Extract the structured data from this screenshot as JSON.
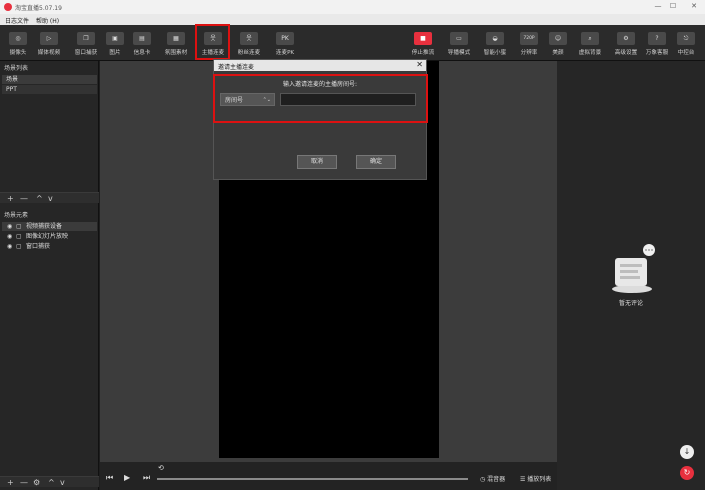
{
  "app": {
    "title": "淘宝直播5.07.19"
  },
  "window_controls": {
    "minimize": "—",
    "maximize": "☐",
    "close": "✕"
  },
  "menu": [
    "日志文件",
    "帮助 (H)"
  ],
  "toolbar": [
    {
      "label": "摄像头",
      "icon": "camera-icon",
      "glyph": "◎"
    },
    {
      "label": "媒体视频",
      "icon": "play-icon",
      "glyph": "▷"
    },
    {
      "label": "窗口捕获",
      "icon": "window-icon",
      "glyph": "❐"
    },
    {
      "label": "图片",
      "icon": "image-icon",
      "glyph": "▣"
    },
    {
      "label": "信息卡",
      "icon": "card-icon",
      "glyph": "▤"
    },
    {
      "label": "氛围素材",
      "icon": "grid-icon",
      "glyph": "▦"
    },
    {
      "label": "主播连麦",
      "icon": "user-link-icon",
      "glyph": "웃"
    },
    {
      "label": "粉丝连麦",
      "icon": "fans-link-icon",
      "glyph": "웃"
    },
    {
      "label": "连麦PK",
      "icon": "pk-icon",
      "glyph": "PK"
    },
    {
      "label": "停止推流",
      "icon": "stop-icon",
      "glyph": "■"
    },
    {
      "label": "导播模式",
      "icon": "director-icon",
      "glyph": "▭"
    },
    {
      "label": "智能小蜜",
      "icon": "assistant-icon",
      "glyph": "◒"
    },
    {
      "label": "分辨率",
      "icon": "resolution-icon",
      "glyph": "720P"
    },
    {
      "label": "美颜",
      "icon": "beauty-icon",
      "glyph": "☺"
    },
    {
      "label": "虚拟背景",
      "icon": "virtual-bg-icon",
      "glyph": "⌕"
    },
    {
      "label": "高级设置",
      "icon": "settings-icon",
      "glyph": "⚙"
    },
    {
      "label": "万象客服",
      "icon": "help-icon",
      "glyph": "?"
    },
    {
      "label": "中控台",
      "icon": "console-icon",
      "glyph": "⎋"
    }
  ],
  "left_panel": {
    "scenes_title": "场景列表",
    "scenes": [
      "场景",
      "PPT"
    ],
    "scene_tools": [
      "+",
      "—",
      "^",
      "v"
    ],
    "sources_title": "场景元素",
    "sources": [
      "视频捕获设备",
      "图像幻灯片放映",
      "窗口捕获"
    ],
    "source_tools": [
      "+",
      "—",
      "⚙",
      "^",
      "v"
    ]
  },
  "dialog": {
    "title": "邀请主播连麦",
    "close": "✕",
    "prompt": "输入邀请连麦的主播房间号:",
    "select_value": "房间号",
    "input_value": "",
    "cancel": "取消",
    "confirm": "确定"
  },
  "bottom_bar": {
    "audio_label": "◷ 混音器",
    "playlist_label": "☰ 播放列表"
  },
  "right_panel": {
    "empty_text": "暂无评论"
  },
  "colors": {
    "accent": "#e8303e",
    "highlight": "#dd1111"
  }
}
